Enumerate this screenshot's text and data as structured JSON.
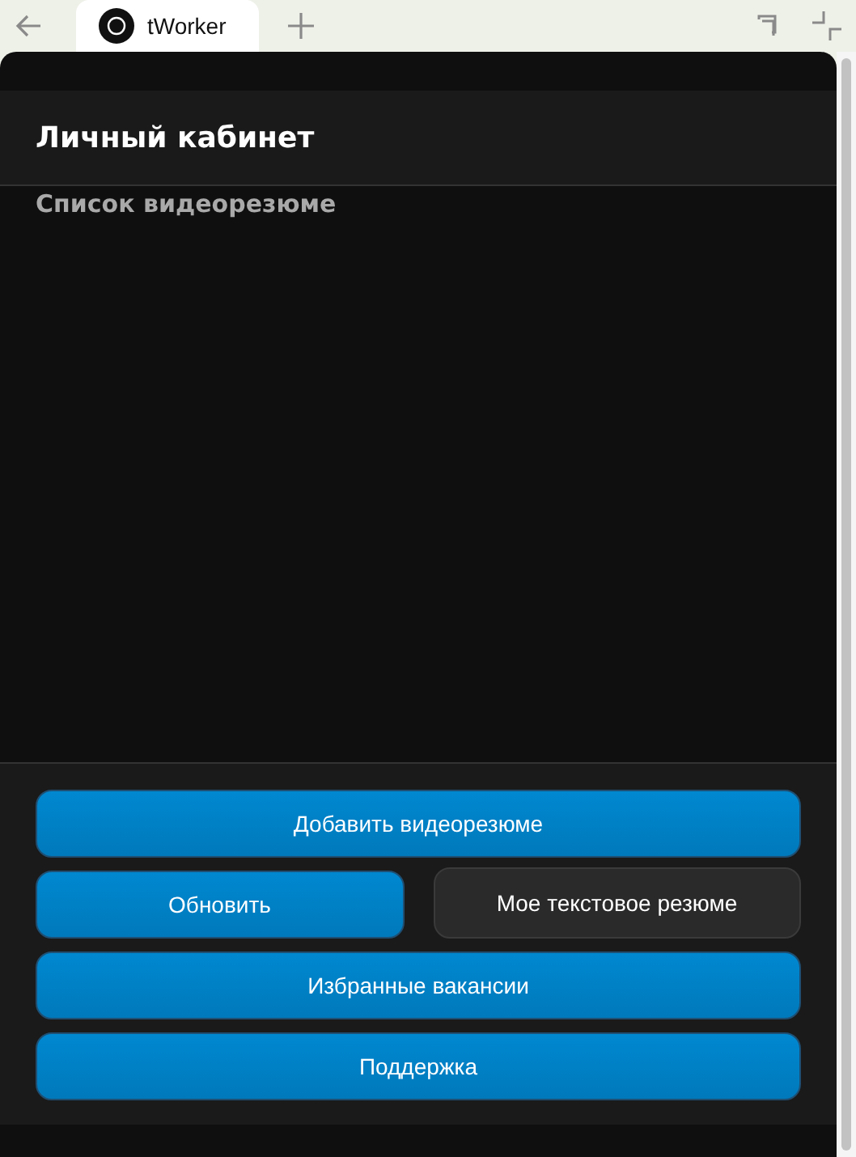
{
  "browser": {
    "tab_title": "tWorker"
  },
  "header": {
    "title": "Личный кабинет"
  },
  "section": {
    "title": "Список видеорезюме"
  },
  "actions": [
    [
      {
        "label": "Добавить видеорезюме",
        "kind": "primary"
      }
    ],
    [
      {
        "label": "Обновить",
        "kind": "primary"
      },
      {
        "label": "Мое текстовое резюме",
        "kind": "secondary"
      }
    ],
    [
      {
        "label": "Избранные вакансии",
        "kind": "primary"
      }
    ],
    [
      {
        "label": "Поддержка",
        "kind": "primary"
      }
    ]
  ]
}
